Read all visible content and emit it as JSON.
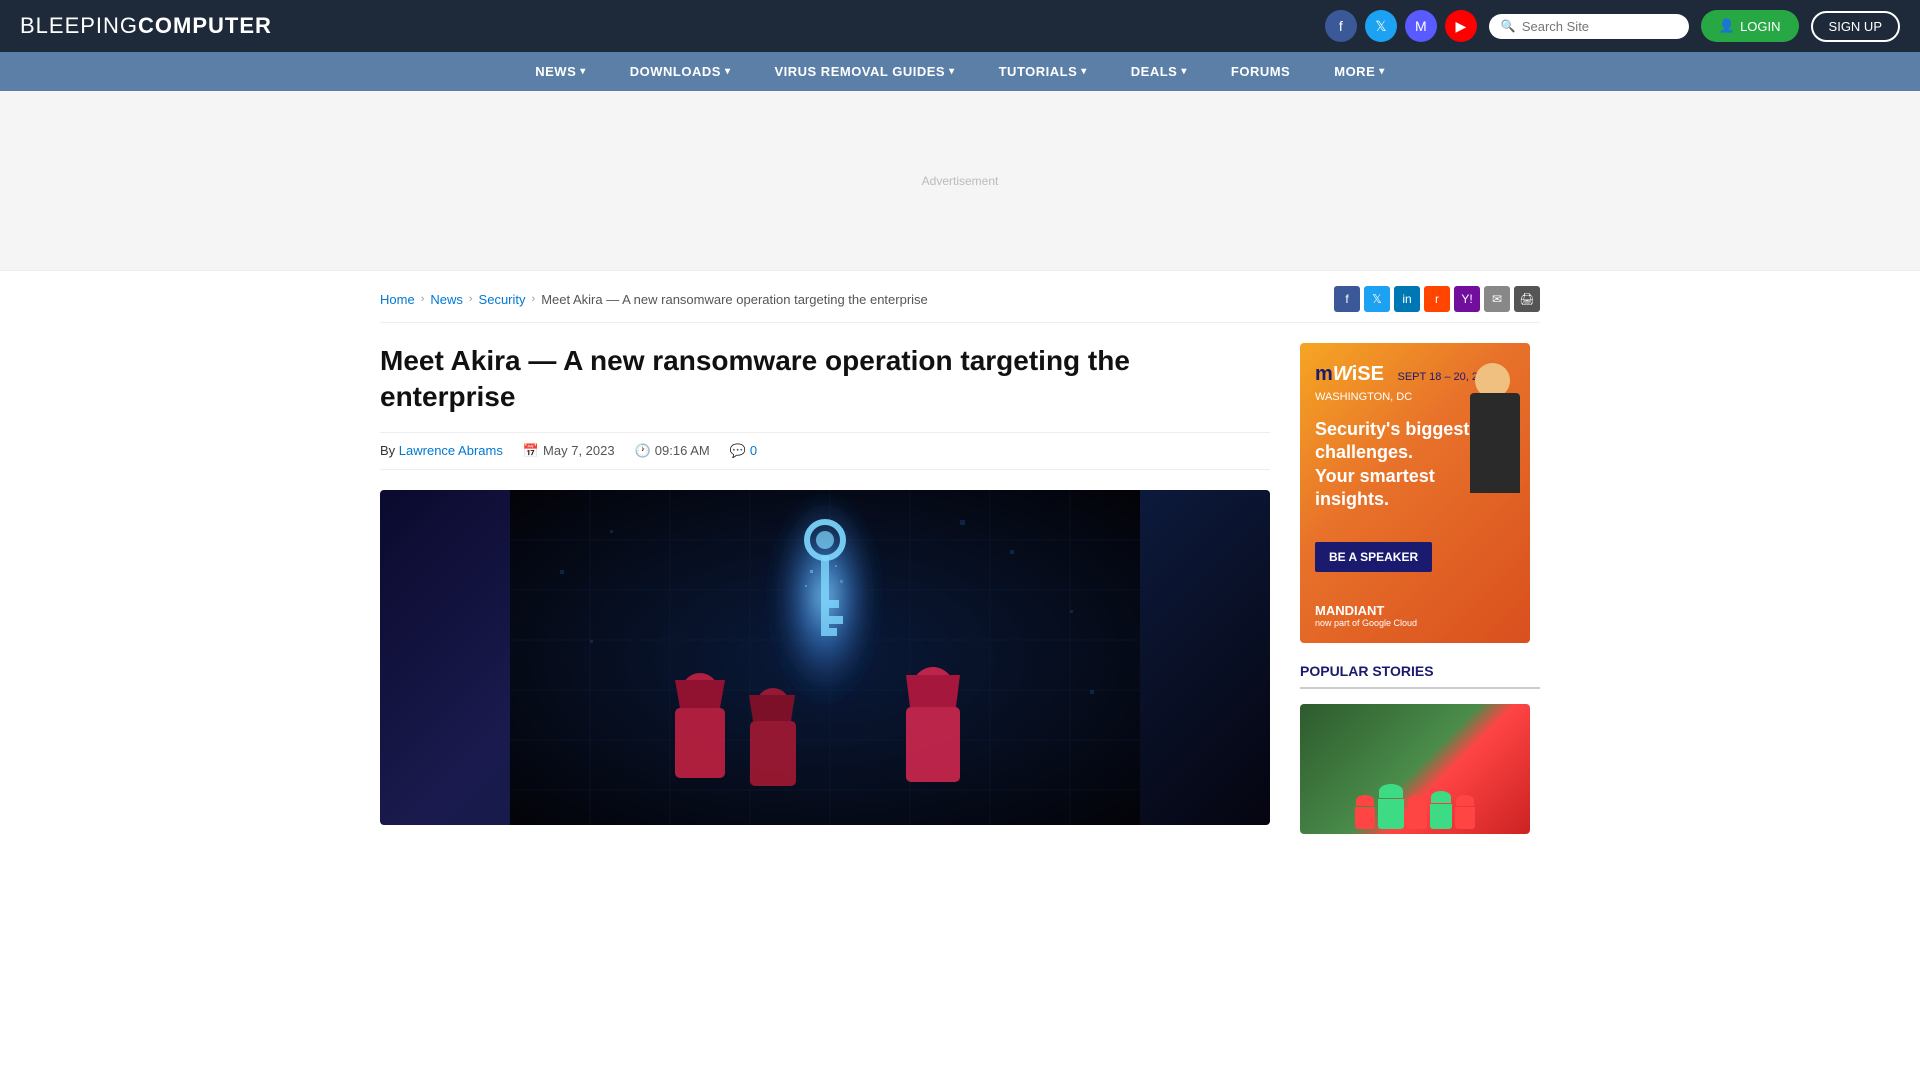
{
  "site": {
    "logo_light": "BLEEPING",
    "logo_bold": "COMPUTER",
    "search_placeholder": "Search Site"
  },
  "header": {
    "social": [
      {
        "name": "facebook",
        "symbol": "f"
      },
      {
        "name": "twitter",
        "symbol": "🐦"
      },
      {
        "name": "mastodon",
        "symbol": "M"
      },
      {
        "name": "youtube",
        "symbol": "▶"
      }
    ],
    "login_label": "LOGIN",
    "signup_label": "SIGN UP"
  },
  "nav": {
    "items": [
      {
        "label": "NEWS",
        "has_arrow": true
      },
      {
        "label": "DOWNLOADS",
        "has_arrow": true
      },
      {
        "label": "VIRUS REMOVAL GUIDES",
        "has_arrow": true
      },
      {
        "label": "TUTORIALS",
        "has_arrow": true
      },
      {
        "label": "DEALS",
        "has_arrow": true
      },
      {
        "label": "FORUMS",
        "has_arrow": false
      },
      {
        "label": "MORE",
        "has_arrow": true
      }
    ]
  },
  "breadcrumb": {
    "items": [
      {
        "label": "Home",
        "href": "#"
      },
      {
        "label": "News",
        "href": "#"
      },
      {
        "label": "Security",
        "href": "#"
      },
      {
        "label": "Meet Akira — A new ransomware operation targeting the enterprise",
        "href": null
      }
    ]
  },
  "share": {
    "label": "Share"
  },
  "article": {
    "title": "Meet Akira — A new ransomware operation targeting the enterprise",
    "author": "Lawrence Abrams",
    "date": "May 7, 2023",
    "time": "09:16 AM",
    "comments": "0",
    "image_alt": "Ransomware cybersecurity concept with digital key and figures"
  },
  "sidebar": {
    "ad": {
      "brand": "mWISE",
      "brand_suffix": "",
      "dates": "SEPT 18 – 20, 2023",
      "location": "WASHINGTON, DC",
      "headline_line1": "Security's biggest",
      "headline_line2": "challenges.",
      "headline_line3": "Your smartest",
      "headline_line4": "insights.",
      "cta": "BE A SPEAKER",
      "sponsor": "MANDIANT",
      "sponsor_sub": "now part of Google Cloud"
    },
    "popular_title": "POPULAR STORIES"
  }
}
